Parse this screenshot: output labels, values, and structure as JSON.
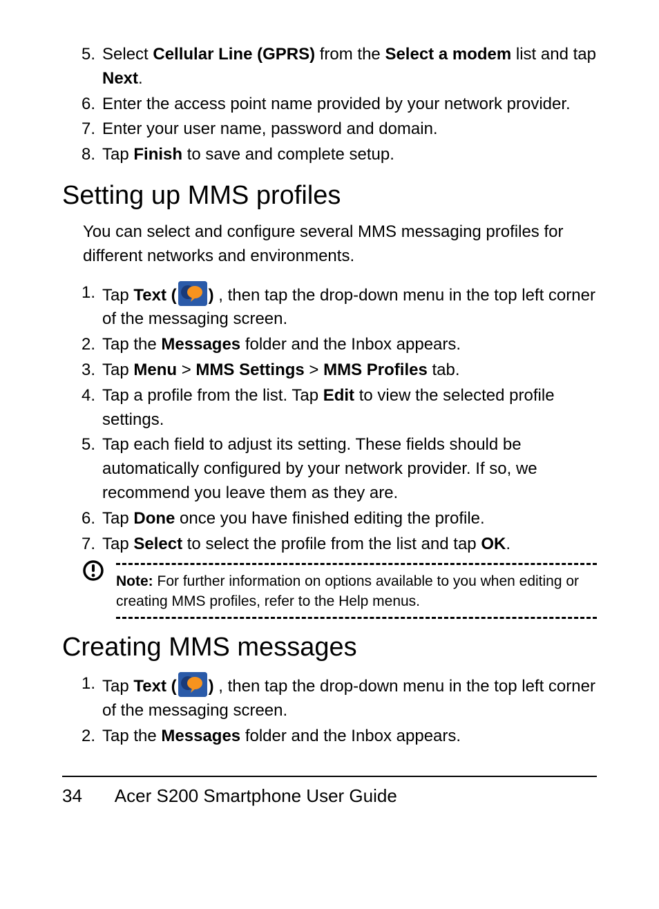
{
  "listA": {
    "start": 5,
    "items": [
      "Select <b>Cellular Line (GPRS)</b> from the <b>Select a modem</b> list and tap <b>Next</b>.",
      "Enter the access point name provided by your network provider.",
      "Enter your user name, password and domain.",
      "Tap <b>Finish</b> to save and complete setup."
    ]
  },
  "heading1": "Setting up MMS profiles",
  "intro1": "You can select and configure several MMS messaging profiles for different networks and environments.",
  "listB": {
    "start": 1,
    "items": [
      "Tap <b>Text (</b>{{ICON}}<b>)</b> , then tap the drop-down menu in the top left corner of the messaging screen.",
      "Tap the <b>Messages</b> folder and the Inbox appears.",
      "Tap <b>Menu</b> > <b>MMS Settings</b> > <b>MMS Profiles</b> tab.",
      "Tap a profile from the list. Tap <b>Edit</b> to view the selected profile settings.",
      "Tap each field to adjust its setting. These fields should be automatically configured by your network provider. If so, we recommend you leave them as they are.",
      "Tap <b>Done</b> once you have finished editing the profile.",
      "Tap <b>Select</b> to select the profile from the list and tap <b>OK</b>."
    ]
  },
  "note": "<b>Note:</b> For further information on options available to you when editing or creating MMS profiles, refer to the Help menus.",
  "heading2": "Creating MMS messages",
  "listC": {
    "start": 1,
    "items": [
      "Tap <b>Text (</b>{{ICON}}<b>)</b> , then tap the drop-down menu in the top left corner of the messaging screen.",
      "Tap the <b>Messages</b> folder and the Inbox appears."
    ]
  },
  "footer": {
    "page": "34",
    "title": "Acer S200 Smartphone User Guide"
  }
}
